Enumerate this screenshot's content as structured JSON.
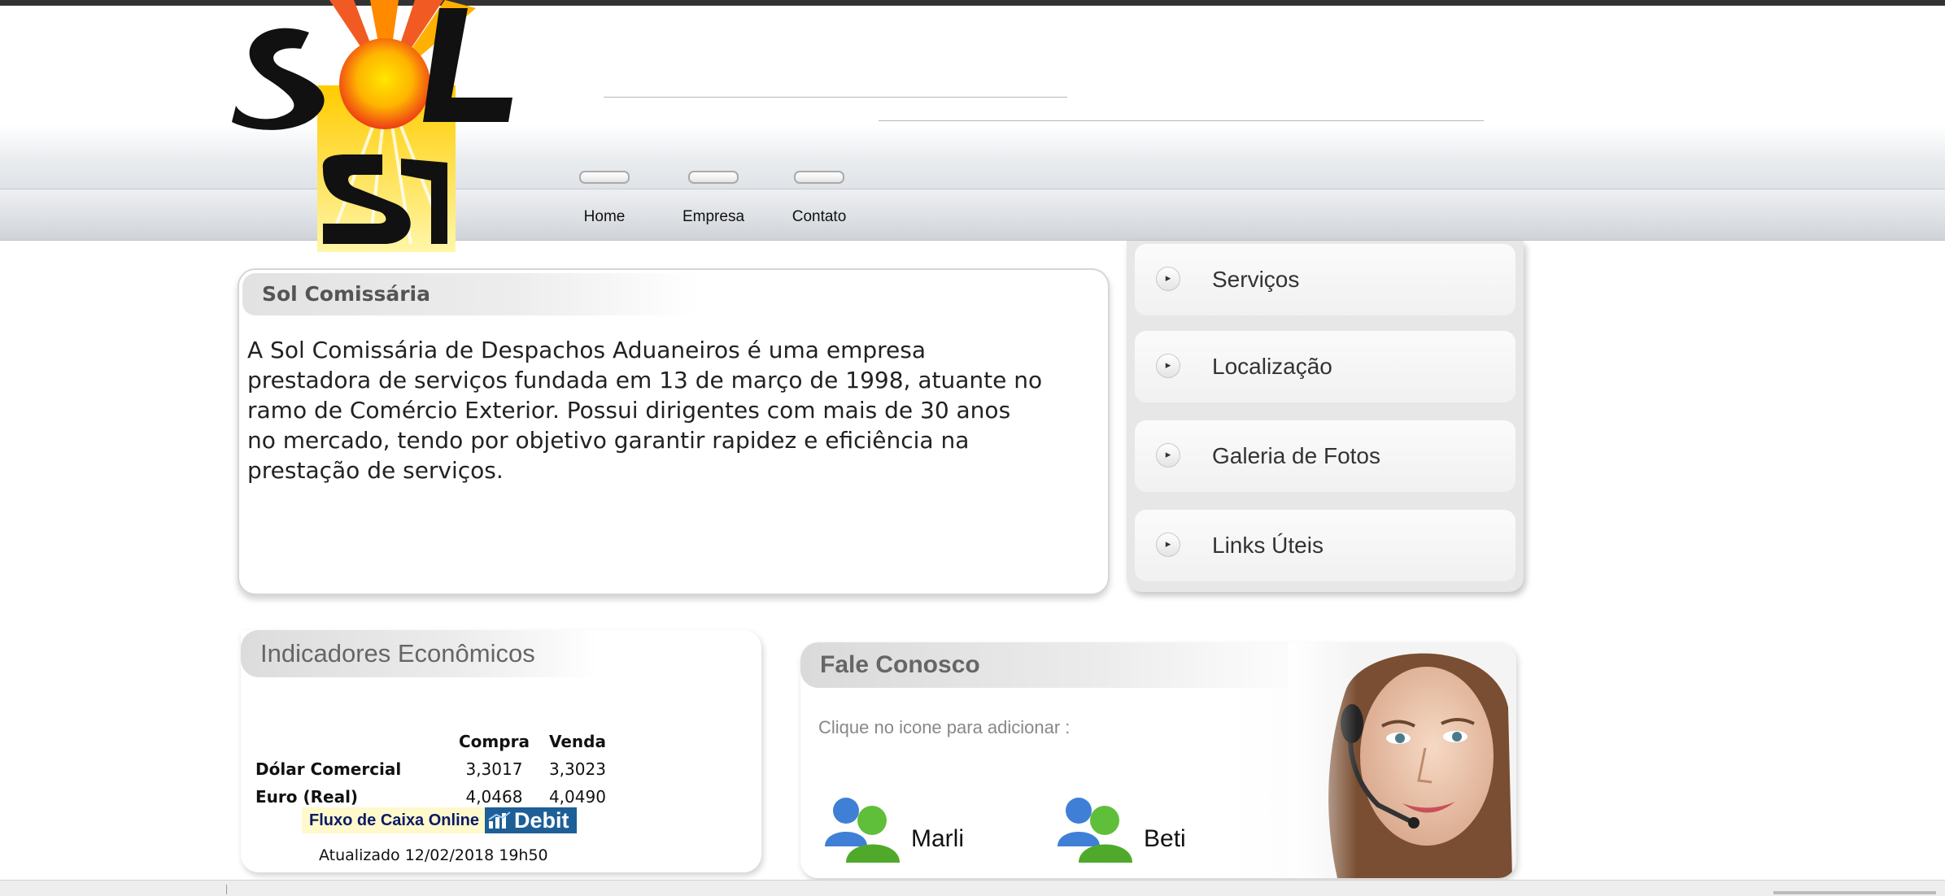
{
  "logo": {
    "text": "SOL"
  },
  "nav": {
    "items": [
      {
        "label": "Home"
      },
      {
        "label": "Empresa"
      },
      {
        "label": "Contato"
      }
    ]
  },
  "about": {
    "title": "Sol Comissária",
    "text": "A Sol Comissária de Despachos Aduaneiros é uma empresa prestadora de serviços  fundada em 13 de março de 1998, atuante no ramo de Comércio Exterior. Possui dirigentes com mais de 30 anos no mercado, tendo por objetivo garantir rapidez e eficiência na prestação de serviços."
  },
  "side_menu": {
    "items": [
      {
        "label": "Serviços",
        "icon": "arrow-bullet-icon"
      },
      {
        "label": "Localização",
        "icon": "arrow-bullet-icon"
      },
      {
        "label": "Galeria de Fotos",
        "icon": "arrow-bullet-icon"
      },
      {
        "label": "Links Úteis",
        "icon": "arrow-bullet-icon"
      }
    ]
  },
  "indicators": {
    "title": "Indicadores Econômicos",
    "columns": [
      "Compra",
      "Venda"
    ],
    "rows": [
      {
        "label": "Dólar Comercial",
        "compra": "3,3017",
        "venda": "3,3023"
      },
      {
        "label": "Euro (Real)",
        "compra": "4,0468",
        "venda": "4,0490"
      }
    ],
    "fluxo_label": "Fluxo de Caixa Online",
    "debit_label": "Debit",
    "updated": "Atualizado 12/02/2018 19h50"
  },
  "contact": {
    "title": "Fale Conosco",
    "hint": "Clique no icone para adicionar :",
    "people": [
      {
        "name": "Marli",
        "icon": "users-icon"
      },
      {
        "name": "Beti",
        "icon": "users-icon"
      }
    ]
  },
  "colors": {
    "accent_blue": "#1d5f96",
    "highlight_yellow": "#fff9cc"
  }
}
